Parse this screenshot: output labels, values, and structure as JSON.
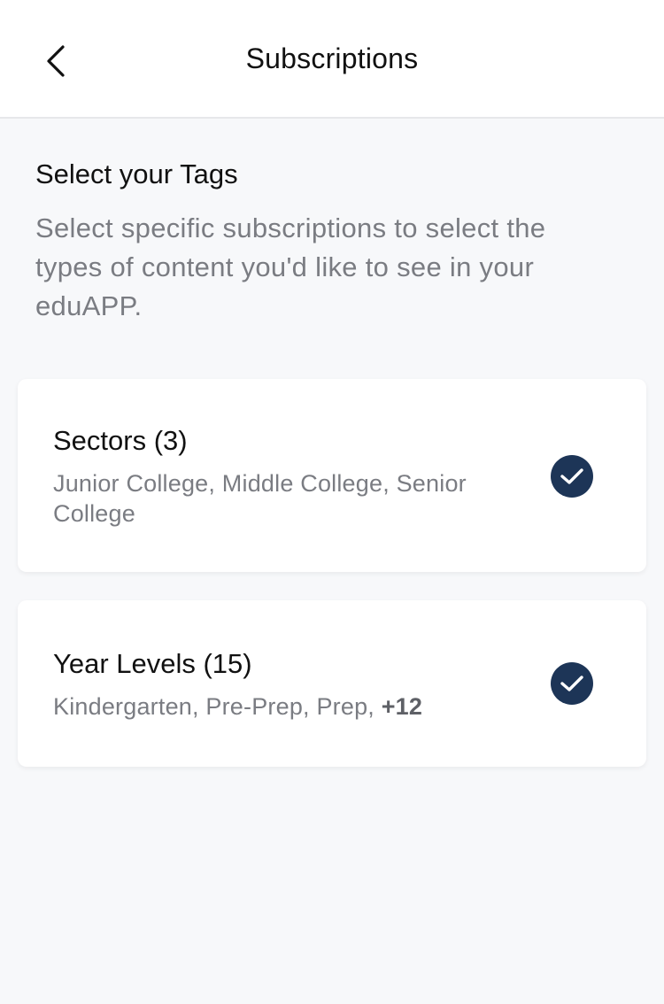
{
  "header": {
    "title": "Subscriptions",
    "back_icon": "chevron-left-icon"
  },
  "intro": {
    "title": "Select your Tags",
    "description": "Select specific subscriptions to select the types of content you'd like to see in your eduAPP."
  },
  "cards": [
    {
      "title": "Sectors (3)",
      "subtitle": "Junior College, Middle College, Senior College",
      "selected": true,
      "icon": "checkmark-circle-icon"
    },
    {
      "title": "Year Levels (15)",
      "subtitle": "Kindergarten, Pre-Prep, Prep, ",
      "more": "+12",
      "selected": true,
      "icon": "checkmark-circle-icon"
    }
  ],
  "colors": {
    "accent": "#1d3557",
    "background": "#f7f8fa",
    "secondary_text": "#7a7c82"
  }
}
